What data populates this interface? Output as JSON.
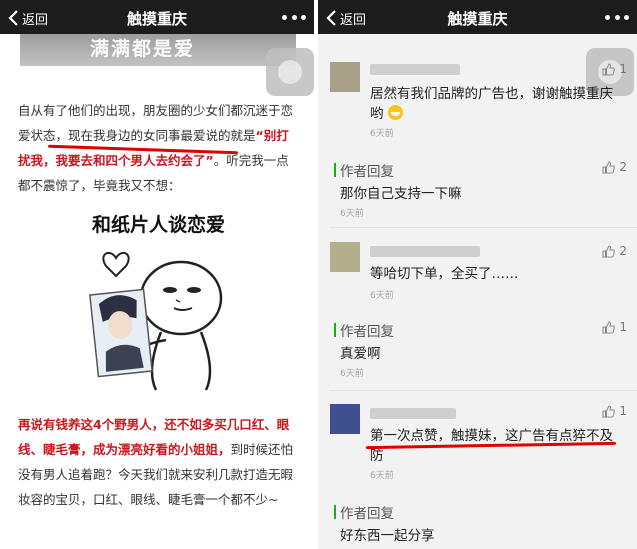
{
  "left": {
    "nav": {
      "back_label": "返回",
      "title": "触摸重庆",
      "back_icon": "chevron-left-icon",
      "more_icon": "more-dots-icon"
    },
    "banner_text": "满满都是爱",
    "paragraph1_a": "自从有了他们的出现，朋友圈的少女们都沉迷于恋爱状态，",
    "paragraph1_b": "现在我身边的女同事最爱说的就是",
    "paragraph1_red": "“别打扰我，我要去和四个男人去约会了”",
    "paragraph1_c": "。听完我一点都不震惊了，毕竟我又不想：",
    "meme_title": "和纸片人谈恋爱",
    "paragraph2_red": "再说有钱养这4个野男人，还不如多买几口红、眼线、睫毛膏，成为漂亮好看的小姐姐，",
    "paragraph2_rest": "到时候还怕没有男人追着跑？今天我们就来安利几款打造无暇妆容的宝贝，口红、眼线、睫毛膏一个都不少~"
  },
  "right": {
    "nav": {
      "back_label": "返回",
      "title": "触摸重庆",
      "back_icon": "chevron-left-icon",
      "more_icon": "more-dots-icon"
    },
    "comments": [
      {
        "text": "居然有我们品牌的广告也，谢谢触摸重庆哟",
        "time": "6天前",
        "likes": "1",
        "reply": {
          "author": "作者回复",
          "text": "那你自己支持一下嘛",
          "time": "6天前",
          "likes": "2"
        }
      },
      {
        "text": "等哈切下单，全买了……",
        "time": "6天前",
        "likes": "2",
        "reply": {
          "author": "作者回复",
          "text": "真爱啊",
          "time": "6天前",
          "likes": "1"
        }
      },
      {
        "text": "第一次点赞，触摸妹，这广告有点猝不及防",
        "time": "6天前",
        "likes": "1",
        "reply": {
          "author": "作者回复",
          "text": "好东西一起分享",
          "time": "",
          "likes": ""
        }
      }
    ]
  },
  "colors": {
    "nav_bg": "#1c1c1c",
    "highlight_red": "#c8171e",
    "underline_red": "#e00000",
    "reply_bar": "#1aad19"
  }
}
